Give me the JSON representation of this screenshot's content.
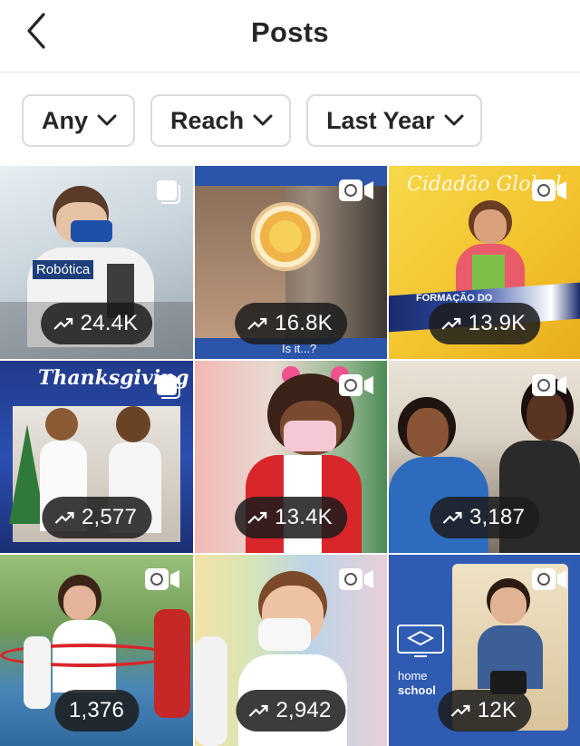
{
  "header": {
    "title": "Posts"
  },
  "filters": [
    {
      "label": "Any"
    },
    {
      "label": "Reach"
    },
    {
      "label": "Last Year"
    }
  ],
  "posts": [
    {
      "stat": "24.4K",
      "type": "carousel",
      "overlay": "Robótica"
    },
    {
      "stat": "16.8K",
      "type": "video",
      "overlay": "Is it...?"
    },
    {
      "stat": "13.9K",
      "type": "video",
      "overlay": "Cidadão Global",
      "overlay2": "FORMAÇÃO DO"
    },
    {
      "stat": "2,577",
      "type": "carousel",
      "overlay": "Thanksgiving"
    },
    {
      "stat": "13.4K",
      "type": "video"
    },
    {
      "stat": "3,187",
      "type": "video"
    },
    {
      "stat": "1,376",
      "type": "video"
    },
    {
      "stat": "2,942",
      "type": "video"
    },
    {
      "stat": "12K",
      "type": "video",
      "overlay": "home",
      "overlay2": "school"
    }
  ],
  "colors": {
    "text": "#262626",
    "border": "#dbdbdb",
    "pill": "#1c1c1c"
  },
  "icons": {
    "back": "chevron-left-icon",
    "dropdown": "chevron-down-icon",
    "trend": "trending-up-icon",
    "carousel": "carousel-icon",
    "video": "video-camera-icon"
  }
}
